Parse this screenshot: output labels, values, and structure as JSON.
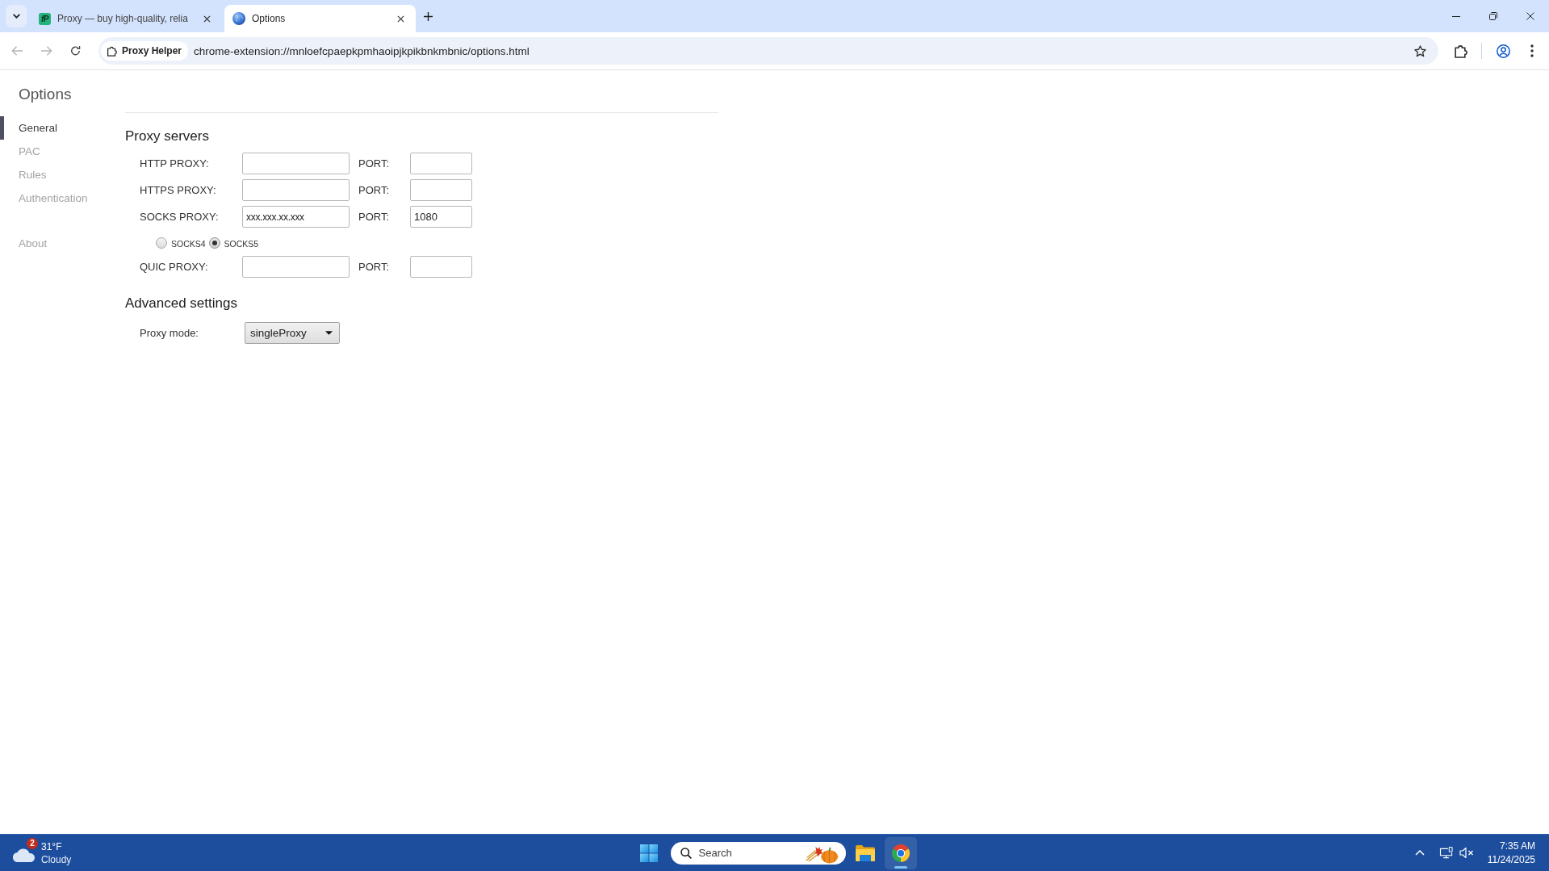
{
  "browser": {
    "tabs": [
      {
        "favicon": {
          "kind": "logo",
          "text": "fP"
        },
        "title": "Proxy — buy high-quality, relia",
        "selected": false
      },
      {
        "favicon": {
          "kind": "globe"
        },
        "title": "Options",
        "selected": true
      }
    ],
    "toolbar": {
      "buttons": [
        {
          "kind": "back",
          "disabled": true
        },
        {
          "kind": "forward",
          "disabled": true
        },
        {
          "kind": "reload",
          "disabled": false
        }
      ],
      "site_chip": "Proxy Helper",
      "url": "chrome-extension://mnloefcpaepkpmhaoipjkpikbnkmbnic/options.html"
    }
  },
  "page": {
    "sidebar": {
      "title": "Options",
      "sections": [
        {
          "items": [
            {
              "label": "General",
              "selected": true
            },
            {
              "label": "PAC",
              "selected": false
            },
            {
              "label": "Rules",
              "selected": false
            },
            {
              "label": "Authentication",
              "selected": false
            }
          ]
        },
        {
          "items": [
            {
              "label": "About",
              "selected": false
            }
          ]
        }
      ]
    },
    "proxy_servers": {
      "heading": "Proxy servers",
      "rows": [
        {
          "kind": "proxy",
          "label": "HTTP PROXY:",
          "port_label": "PORT:"
        },
        {
          "kind": "proxy",
          "label": "HTTPS PROXY:",
          "port_label": "PORT:"
        },
        {
          "kind": "proxy",
          "label": "SOCKS PROXY:",
          "value": "xxx.xxx.xx.xxx",
          "port_label": "PORT:",
          "port": "1080"
        },
        {
          "kind": "radio_group",
          "options": [
            {
              "label": "SOCKS4",
              "selected": false
            },
            {
              "label": "SOCKS5",
              "selected": true
            }
          ]
        },
        {
          "kind": "proxy",
          "label": "QUIC PROXY:",
          "port_label": "PORT:"
        }
      ]
    },
    "advanced_settings": {
      "heading": "Advanced settings",
      "proxy_mode": {
        "label": "Proxy mode:",
        "value": "singleProxy"
      }
    }
  },
  "taskbar": {
    "weather": {
      "badge": "2",
      "temperature": "31°F",
      "condition": "Cloudy"
    },
    "search": {
      "placeholder": "Search"
    },
    "apps": [
      {
        "kind": "file_explorer",
        "active": false
      },
      {
        "kind": "chrome",
        "active": true
      }
    ],
    "tray": {
      "volume_muted": true
    },
    "clock": {
      "time": "7:35 AM",
      "date": "11/24/2025"
    }
  }
}
